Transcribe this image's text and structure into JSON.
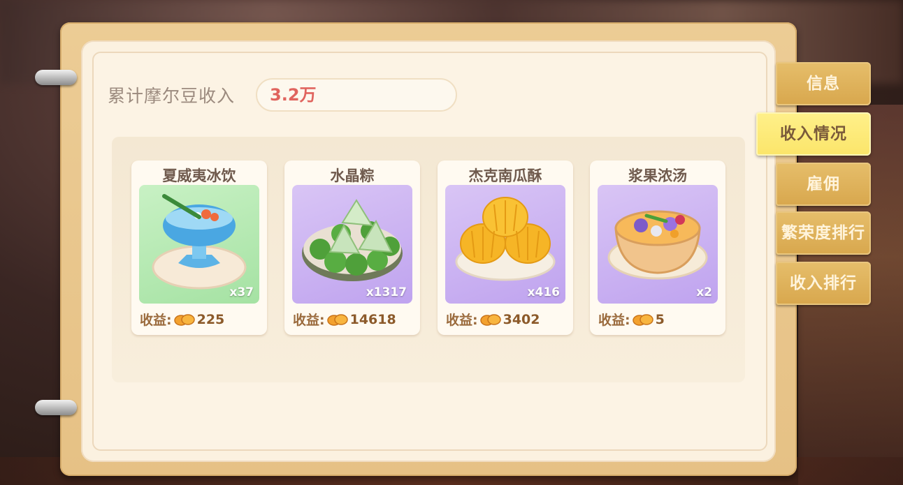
{
  "summary": {
    "label": "累计摩尔豆收入",
    "value": "3.2万"
  },
  "items": [
    {
      "name": "夏威夷冰饮",
      "count": "x37",
      "earn_label": "收益:",
      "earn_value": "225",
      "bg": "green"
    },
    {
      "name": "水晶粽",
      "count": "x1317",
      "earn_label": "收益:",
      "earn_value": "14618",
      "bg": "purple"
    },
    {
      "name": "杰克南瓜酥",
      "count": "x416",
      "earn_label": "收益:",
      "earn_value": "3402",
      "bg": "purple"
    },
    {
      "name": "浆果浓汤",
      "count": "x2",
      "earn_label": "收益:",
      "earn_value": "5",
      "bg": "purple"
    }
  ],
  "tabs": [
    {
      "label": "信息",
      "active": false
    },
    {
      "label": "收入情况",
      "active": true
    },
    {
      "label": "雇佣",
      "active": false
    },
    {
      "label": "繁荣度排行",
      "active": false
    },
    {
      "label": "收入排行",
      "active": false
    }
  ],
  "colors": {
    "accent_value": "#e0645e",
    "tab_active": "#fbe56a",
    "tab_inactive": "#d8a74d"
  },
  "icons": {
    "currency": "mole-bean-icon"
  }
}
